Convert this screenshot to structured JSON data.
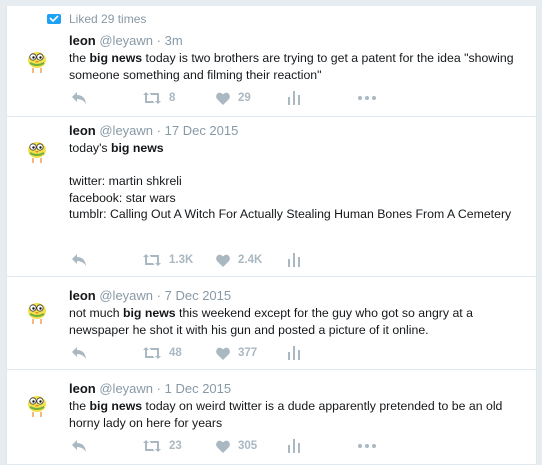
{
  "tweets": [
    {
      "context": "Liked 29 times",
      "name": "leon",
      "handle": "@leyawn",
      "sep": "·",
      "time": "3m",
      "text_before": "the ",
      "bold": "big news",
      "text_after": " today is two brothers are trying to get a patent for the idea \"showing someone something and filming their reaction\"",
      "retweets": "8",
      "likes": "29"
    },
    {
      "name": "leon",
      "handle": "@leyawn",
      "sep": "·",
      "time": "17 Dec 2015",
      "text_before": "today's ",
      "bold": "big news",
      "text_after": "\n\ntwitter: martin shkreli\nfacebook: star wars\ntumblr: Calling Out A Witch For Actually Stealing Human Bones From A Cemetery",
      "retweets": "1.3K",
      "likes": "2.4K"
    },
    {
      "name": "leon",
      "handle": "@leyawn",
      "sep": "·",
      "time": "7 Dec 2015",
      "text_before": "not much ",
      "bold": "big news",
      "text_after": " this weekend except for the guy who got so angry at a newspaper he shot it with his gun and posted a picture of it online.",
      "retweets": "48",
      "likes": "377"
    },
    {
      "name": "leon",
      "handle": "@leyawn",
      "sep": "·",
      "time": "1 Dec 2015",
      "text_before": "the ",
      "bold": "big news",
      "text_after": " today on weird twitter is a dude apparently pretended to be an old horny lady on here for years",
      "retweets": "23",
      "likes": "305"
    }
  ],
  "colors": {
    "icon": "#aab8c2",
    "context_icon": "#1da1f2",
    "name": "#14171a",
    "muted": "#8899a6",
    "divider": "#e1e8ed"
  },
  "icons": {
    "context": "liked-notification-icon",
    "reply": "reply-icon",
    "retweet": "retweet-icon",
    "like": "heart-icon",
    "analytics": "analytics-icon",
    "more": "more-icon"
  }
}
